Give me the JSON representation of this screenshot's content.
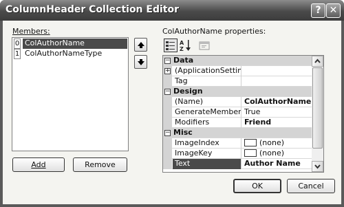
{
  "window": {
    "title": "ColumnHeader Collection Editor",
    "help_glyph": "?",
    "close_glyph": "✕"
  },
  "members": {
    "label": "Members:",
    "items": [
      {
        "index": "0",
        "name": "ColAuthorName",
        "selected": true
      },
      {
        "index": "1",
        "name": "ColAuthorNameType",
        "selected": false
      }
    ],
    "add_label": "Add",
    "remove_label": "Remove"
  },
  "properties": {
    "label": "ColAuthorName properties:",
    "toolbar": [
      "categorized-icon",
      "alphabetical-icon",
      "property-pages-icon"
    ],
    "rows": [
      {
        "kind": "category",
        "name": "Data",
        "expander": "−"
      },
      {
        "kind": "prop",
        "expander": "+",
        "name": "(ApplicationSettings)",
        "value": ""
      },
      {
        "kind": "prop",
        "name": "Tag",
        "value": ""
      },
      {
        "kind": "category",
        "name": "Design",
        "expander": "−"
      },
      {
        "kind": "prop",
        "name": "(Name)",
        "value": "ColAuthorName",
        "bold": true
      },
      {
        "kind": "prop",
        "name": "GenerateMember",
        "value": "True"
      },
      {
        "kind": "prop",
        "name": "Modifiers",
        "value": "Friend",
        "bold": true
      },
      {
        "kind": "category",
        "name": "Misc",
        "expander": "−"
      },
      {
        "kind": "prop",
        "name": "ImageIndex",
        "value": "(none)",
        "swatch": true
      },
      {
        "kind": "prop",
        "name": "ImageKey",
        "value": "(none)",
        "swatch": true
      },
      {
        "kind": "prop",
        "name": "Text",
        "value": "Author Name",
        "bold": true,
        "selected": true
      }
    ]
  },
  "buttons": {
    "ok_label": "OK",
    "cancel_label": "Cancel"
  }
}
